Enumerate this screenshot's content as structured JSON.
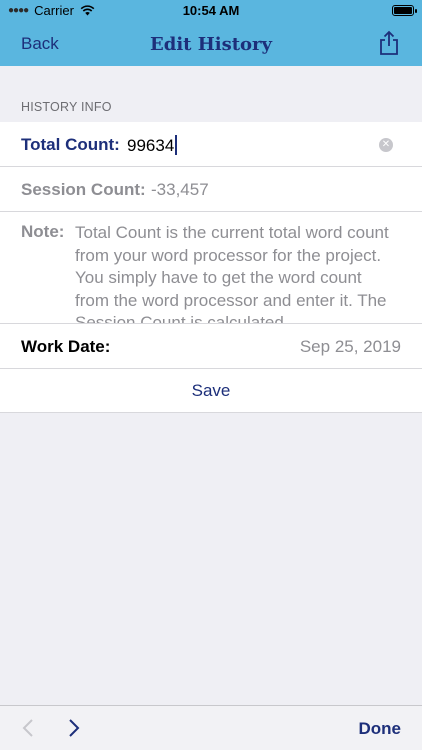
{
  "status": {
    "carrier": "Carrier",
    "time": "10:54 AM"
  },
  "nav": {
    "back_label": "Back",
    "title": "Edit History"
  },
  "section": {
    "header": "HISTORY INFO"
  },
  "form": {
    "total_label": "Total Count:",
    "total_value": "99634",
    "session_label": "Session Count:",
    "session_value": "-33,457",
    "note_label": "Note:",
    "note_text": "Total Count is the current total word count from your word processor for the project. You simply have to get the word count from the word processor and enter it. The Session Count is calculated",
    "work_label": "Work Date:",
    "work_value": "Sep 25, 2019",
    "save_label": "Save"
  },
  "toolbar": {
    "done_label": "Done"
  },
  "colors": {
    "nav_background": "#5ab6df",
    "accent": "#1d2f7a",
    "secondary_text": "#8e8e93",
    "background": "#efeff4"
  }
}
